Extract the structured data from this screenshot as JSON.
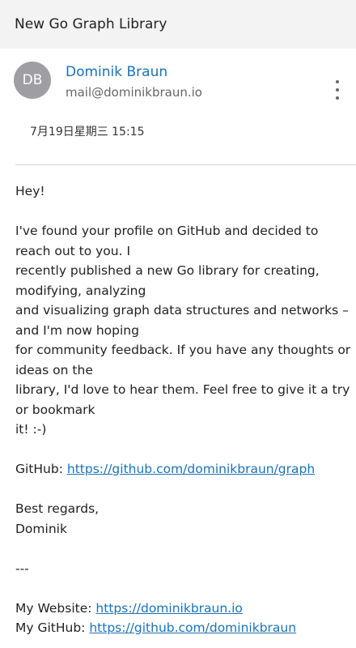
{
  "email": {
    "subject": "New Go Graph Library",
    "sender": {
      "initials": "DB",
      "name": "Dominik Braun",
      "email": "mail@dominikbraun.io"
    },
    "date": "7月19日星期三 15:15",
    "body": {
      "greeting": "Hey!",
      "paragraph_lines": [
        "I've found your profile on GitHub and decided to",
        "reach out to you. I",
        "recently published a new Go library for creating,",
        "modifying, analyzing",
        "and visualizing graph data structures and networks –",
        "and I'm now hoping",
        "for community feedback. If you have any thoughts or",
        "ideas on the",
        "library, I'd love to hear them. Feel free to give it a try",
        "or bookmark",
        "it! :-)"
      ],
      "github_label": "GitHub: ",
      "github_link": "https://github.com/dominikbraun/graph",
      "closing": "Best regards,",
      "signature": "Dominik",
      "separator": "---",
      "website_label": "My Website: ",
      "website_link": "https://dominikbraun.io",
      "mygithub_label": "My GitHub: ",
      "mygithub_link": "https://github.com/dominikbraun"
    }
  }
}
